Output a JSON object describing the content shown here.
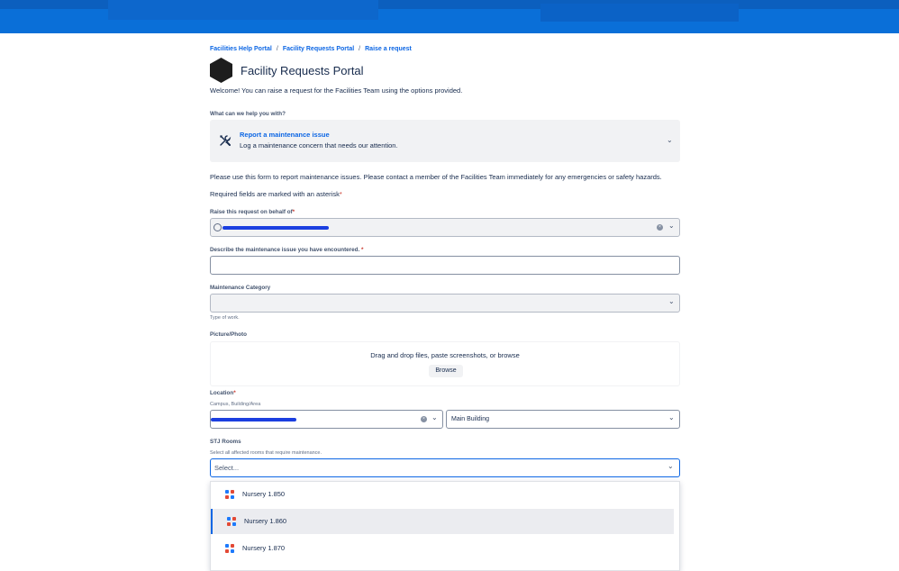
{
  "breadcrumbs": [
    "Facilities Help Portal",
    "Facility Requests Portal",
    "Raise a request"
  ],
  "breadcrumb_separator": "/",
  "portal_title": "Facility Requests Portal",
  "welcome_text": "Welcome! You can raise a request for the Facilities Team using the options provided.",
  "request_type": {
    "question": "What can we help you with?",
    "name": "Report a maintenance issue",
    "description": "Log a maintenance concern that needs our attention.",
    "icon": "tools-icon"
  },
  "instructions": "Please use this form to report maintenance issues. Please contact a member of the Facilities Team immediately for any emergencies or safety hazards.",
  "required_note": "Required fields are marked with an asterisk",
  "asterisk": "*",
  "on_behalf": {
    "label": "Raise this request on behalf of"
  },
  "describe": {
    "label": "Describe the maintenance issue you have encountered."
  },
  "category": {
    "label": "Maintenance Category",
    "help": "Type of work."
  },
  "picture": {
    "label": "Picture/Photo",
    "dropzone_text": "Drag and drop files, paste screenshots, or browse",
    "browse_label": "Browse"
  },
  "location": {
    "label": "Location",
    "help": "Campus, Building/Area",
    "building_value": "Main Building"
  },
  "rooms": {
    "label": "STJ Rooms",
    "help": "Select all affected rooms that require maintenance.",
    "placeholder": "Select...",
    "options": [
      "Nursery 1.850",
      "Nursery 1.860",
      "Nursery 1.870"
    ]
  },
  "colors": {
    "accent": "#0c66e4",
    "banner": "#0a6fd8",
    "required": "#c9372c",
    "redaction": "#1b3fe0"
  }
}
